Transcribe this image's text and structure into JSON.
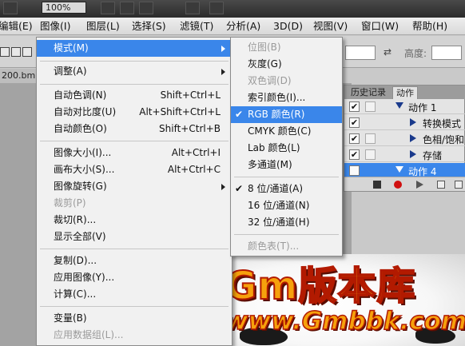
{
  "toolbar": {
    "zoom": "100%"
  },
  "menubar": {
    "items": [
      "编辑(E)",
      "图像(I)",
      "图层(L)",
      "选择(S)",
      "滤镜(T)",
      "分析(A)",
      "3D(D)",
      "视图(V)",
      "窗口(W)",
      "帮助(H)"
    ]
  },
  "options": {
    "swap_icon": "swap-arrows-icon",
    "height_label": "高度:"
  },
  "document": {
    "tab_label": "200.bmp"
  },
  "image_menu": {
    "items": [
      {
        "label": "模式(M)",
        "shortcut": "",
        "submenu": true
      },
      {
        "label": "调整(A)",
        "shortcut": "",
        "submenu": true
      },
      {
        "label": "自动色调(N)",
        "shortcut": "Shift+Ctrl+L"
      },
      {
        "label": "自动对比度(U)",
        "shortcut": "Alt+Shift+Ctrl+L"
      },
      {
        "label": "自动颜色(O)",
        "shortcut": "Shift+Ctrl+B"
      },
      {
        "label": "图像大小(I)...",
        "shortcut": "Alt+Ctrl+I"
      },
      {
        "label": "画布大小(S)...",
        "shortcut": "Alt+Ctrl+C"
      },
      {
        "label": "图像旋转(G)",
        "shortcut": "",
        "submenu": true
      },
      {
        "label": "裁剪(P)",
        "shortcut": "",
        "disabled": true
      },
      {
        "label": "裁切(R)...",
        "shortcut": ""
      },
      {
        "label": "显示全部(V)",
        "shortcut": ""
      },
      {
        "label": "复制(D)...",
        "shortcut": ""
      },
      {
        "label": "应用图像(Y)...",
        "shortcut": ""
      },
      {
        "label": "计算(C)...",
        "shortcut": ""
      },
      {
        "label": "变量(B)",
        "shortcut": ""
      },
      {
        "label": "应用数据组(L)...",
        "shortcut": "",
        "disabled": true
      }
    ]
  },
  "mode_submenu": {
    "items": [
      {
        "label": "位图(B)",
        "disabled": true
      },
      {
        "label": "灰度(G)"
      },
      {
        "label": "双色调(D)",
        "disabled": true
      },
      {
        "label": "索引颜色(I)..."
      },
      {
        "label": "RGB 颜色(R)",
        "checked": true,
        "highlighted": true
      },
      {
        "label": "CMYK 颜色(C)"
      },
      {
        "label": "Lab 颜色(L)"
      },
      {
        "label": "多通道(M)"
      },
      {
        "label": "8 位/通道(A)",
        "checked": true
      },
      {
        "label": "16 位/通道(N)"
      },
      {
        "label": "32 位/通道(H)"
      },
      {
        "label": "颜色表(T)...",
        "disabled": true
      }
    ]
  },
  "actions_panel": {
    "tabs": [
      "历史记录",
      "动作"
    ],
    "rows": [
      {
        "label": "动作 1",
        "expanded": true
      },
      {
        "label": "转换模式"
      },
      {
        "label": "色相/饱和"
      },
      {
        "label": "存储"
      },
      {
        "label": "动作 4",
        "selected": true
      }
    ]
  },
  "watermark": {
    "line1": "Gm版本库",
    "line2": "www.Gmbbk.com"
  },
  "colors": {
    "highlight": "#3a86ea",
    "menu_bg": "#f1f1f1",
    "watermark_fill": "#f6a10c",
    "watermark_stroke": "#b21a00"
  }
}
